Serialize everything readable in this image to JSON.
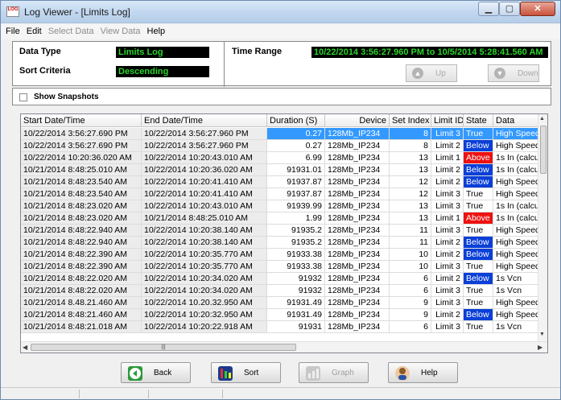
{
  "window": {
    "title": "Log Viewer - [Limits Log]",
    "icon_text": "LOG"
  },
  "menu": [
    {
      "label": "File",
      "enabled": true
    },
    {
      "label": "Edit",
      "enabled": true
    },
    {
      "label": "Select Data",
      "enabled": false
    },
    {
      "label": "View Data",
      "enabled": false
    },
    {
      "label": "Help",
      "enabled": true
    }
  ],
  "panel": {
    "data_type_label": "Data Type",
    "data_type_value": "Limits Log",
    "sort_criteria_label": "Sort Criteria",
    "sort_criteria_value": "Descending",
    "time_range_label": "Time Range",
    "time_range_value": "10/22/2014 3:56:27.960 PM to 10/5/2014 5:28:41.560 AM",
    "up_label": "Up",
    "down_label": "Down"
  },
  "snapshots_label": "Show Snapshots",
  "table": {
    "columns": [
      "Start Date/Time",
      "End Date/Time",
      "Duration (S)",
      "Device",
      "Set Index",
      "Limit ID",
      "State",
      "Data"
    ],
    "rows": [
      [
        "10/22/2014 3:56:27.690 PM",
        "10/22/2014 3:56:27.960 PM",
        "0.27",
        "128Mb_IP234",
        "8",
        "Limit 3",
        "True",
        "High Speed"
      ],
      [
        "10/22/2014 3:56:27.690 PM",
        "10/22/2014 3:56:27.960 PM",
        "0.27",
        "128Mb_IP234",
        "8",
        "Limit 2",
        "Below",
        "High Speed"
      ],
      [
        "10/22/2014 10:20:36.020 AM",
        "10/22/2014 10:20:43.010 AM",
        "6.99",
        "128Mb_IP234",
        "13",
        "Limit 1",
        "Above",
        "1s In (calcu"
      ],
      [
        "10/21/2014 8:48:25.010 AM",
        "10/22/2014 10:20:36.020 AM",
        "91931.01",
        "128Mb_IP234",
        "13",
        "Limit 2",
        "Below",
        "1s In (calcu"
      ],
      [
        "10/21/2014 8:48:23.540 AM",
        "10/22/2014 10:20:41.410 AM",
        "91937.87",
        "128Mb_IP234",
        "12",
        "Limit 2",
        "Below",
        "High Speed"
      ],
      [
        "10/21/2014 8:48:23.540 AM",
        "10/22/2014 10:20:41.410 AM",
        "91937.87",
        "128Mb_IP234",
        "12",
        "Limit 3",
        "True",
        "High Speed"
      ],
      [
        "10/21/2014 8:48:23.020 AM",
        "10/22/2014 10:20:43.010 AM",
        "91939.99",
        "128Mb_IP234",
        "13",
        "Limit 3",
        "True",
        "1s In (calcu"
      ],
      [
        "10/21/2014 8:48:23.020 AM",
        "10/21/2014 8:48:25.010 AM",
        "1.99",
        "128Mb_IP234",
        "13",
        "Limit 1",
        "Above",
        "1s In (calcu"
      ],
      [
        "10/21/2014 8:48:22.940 AM",
        "10/22/2014 10:20:38.140 AM",
        "91935.2",
        "128Mb_IP234",
        "11",
        "Limit 3",
        "True",
        "High Speed"
      ],
      [
        "10/21/2014 8:48:22.940 AM",
        "10/22/2014 10:20:38.140 AM",
        "91935.2",
        "128Mb_IP234",
        "11",
        "Limit 2",
        "Below",
        "High Speed"
      ],
      [
        "10/21/2014 8:48:22.390 AM",
        "10/22/2014 10:20:35.770 AM",
        "91933.38",
        "128Mb_IP234",
        "10",
        "Limit 2",
        "Below",
        "High Speed"
      ],
      [
        "10/21/2014 8:48:22.390 AM",
        "10/22/2014 10:20:35.770 AM",
        "91933.38",
        "128Mb_IP234",
        "10",
        "Limit 3",
        "True",
        "High Speed"
      ],
      [
        "10/21/2014 8:48:22.020 AM",
        "10/22/2014 10:20:34.020 AM",
        "91932",
        "128Mb_IP234",
        "6",
        "Limit 2",
        "Below",
        "1s Vcn"
      ],
      [
        "10/21/2014 8:48:22.020 AM",
        "10/22/2014 10:20:34.020 AM",
        "91932",
        "128Mb_IP234",
        "6",
        "Limit 3",
        "True",
        "1s Vcn"
      ],
      [
        "10/21/2014 8.48.21.460 AM",
        "10/22/2014 10.20.32.950 AM",
        "91931.49",
        "128Mb_IP234",
        "9",
        "Limit 3",
        "True",
        "High Speed"
      ],
      [
        "10/21/2014 8:48:21.460 AM",
        "10/22/2014 10:20:32.950 AM",
        "91931.49",
        "128Mb_IP234",
        "9",
        "Limit 2",
        "Below",
        "High Speed"
      ],
      [
        "10/21/2014 8:48:21.018 AM",
        "10/22/2014 10:20:22.918 AM",
        "91931",
        "128Mb_IP234",
        "6",
        "Limit 3",
        "True",
        "1s Vcn"
      ]
    ],
    "selected_row": 0,
    "state_colors": {
      "Below": "#0a3fd8",
      "Above": "#ee1111"
    }
  },
  "buttons": {
    "back": "Back",
    "sort": "Sort",
    "graph": "Graph",
    "help": "Help"
  },
  "colors": {
    "display_bg": "#000000",
    "display_fg": "#2ad52a",
    "selection": "#3399ff"
  }
}
